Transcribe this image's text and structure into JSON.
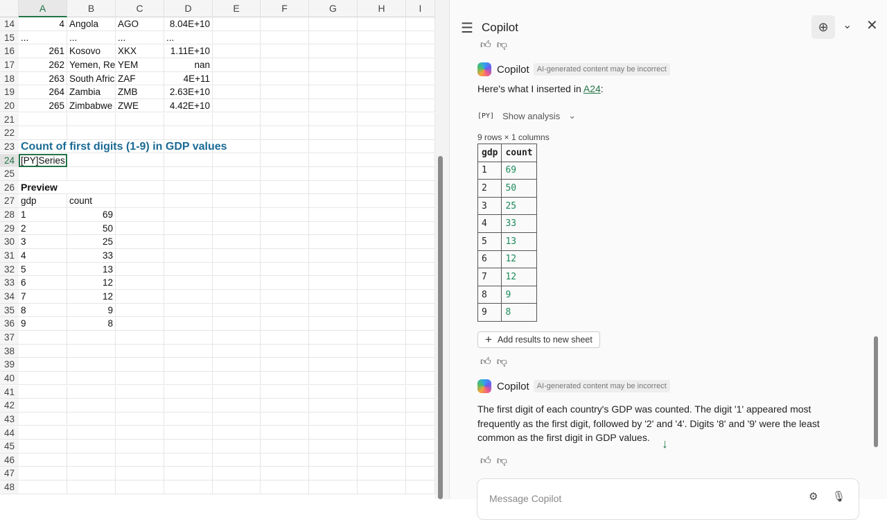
{
  "sheet": {
    "columns": [
      "A",
      "B",
      "C",
      "D",
      "E",
      "F",
      "G",
      "H",
      "I"
    ],
    "rows": [
      {
        "n": "14",
        "cells": [
          {
            "v": "4",
            "num": true
          },
          {
            "v": "Angola"
          },
          {
            "v": "AGO"
          },
          {
            "v": "8.04E+10",
            "num": true
          }
        ]
      },
      {
        "n": "15",
        "cells": [
          {
            "v": "..."
          },
          {
            "v": "..."
          },
          {
            "v": "..."
          },
          {
            "v": "..."
          }
        ]
      },
      {
        "n": "16",
        "cells": [
          {
            "v": "261",
            "num": true
          },
          {
            "v": "Kosovo"
          },
          {
            "v": "XKX"
          },
          {
            "v": "1.11E+10",
            "num": true
          }
        ]
      },
      {
        "n": "17",
        "cells": [
          {
            "v": "262",
            "num": true
          },
          {
            "v": "Yemen, Rep"
          },
          {
            "v": "YEM"
          },
          {
            "v": "nan",
            "num": true
          }
        ]
      },
      {
        "n": "18",
        "cells": [
          {
            "v": "263",
            "num": true
          },
          {
            "v": "South Africa"
          },
          {
            "v": "ZAF"
          },
          {
            "v": "4E+11",
            "num": true
          }
        ]
      },
      {
        "n": "19",
        "cells": [
          {
            "v": "264",
            "num": true
          },
          {
            "v": "Zambia"
          },
          {
            "v": "ZMB"
          },
          {
            "v": "2.63E+10",
            "num": true
          }
        ]
      },
      {
        "n": "20",
        "cells": [
          {
            "v": "265",
            "num": true
          },
          {
            "v": "Zimbabwe"
          },
          {
            "v": "ZWE"
          },
          {
            "v": "4.42E+10",
            "num": true
          }
        ]
      },
      {
        "n": "21",
        "cells": []
      },
      {
        "n": "22",
        "cells": []
      },
      {
        "n": "23",
        "cells": [
          {
            "v": "Count of first digits (1-9) in GDP values",
            "cls": "title ovf"
          }
        ]
      },
      {
        "n": "24",
        "cells": [
          {
            "v": "[PY]Series",
            "cls": "active"
          }
        ]
      },
      {
        "n": "25",
        "cells": []
      },
      {
        "n": "26",
        "cells": [
          {
            "v": "Preview",
            "cls": "bold ovf"
          }
        ]
      },
      {
        "n": "27",
        "cells": [
          {
            "v": "gdp"
          },
          {
            "v": "count"
          }
        ]
      },
      {
        "n": "28",
        "cells": [
          {
            "v": "1"
          },
          {
            "v": "69",
            "num": true
          }
        ]
      },
      {
        "n": "29",
        "cells": [
          {
            "v": "2"
          },
          {
            "v": "50",
            "num": true
          }
        ]
      },
      {
        "n": "30",
        "cells": [
          {
            "v": "3"
          },
          {
            "v": "25",
            "num": true
          }
        ]
      },
      {
        "n": "31",
        "cells": [
          {
            "v": "4"
          },
          {
            "v": "33",
            "num": true
          }
        ]
      },
      {
        "n": "32",
        "cells": [
          {
            "v": "5"
          },
          {
            "v": "13",
            "num": true
          }
        ]
      },
      {
        "n": "33",
        "cells": [
          {
            "v": "6"
          },
          {
            "v": "12",
            "num": true
          }
        ]
      },
      {
        "n": "34",
        "cells": [
          {
            "v": "7"
          },
          {
            "v": "12",
            "num": true
          }
        ]
      },
      {
        "n": "35",
        "cells": [
          {
            "v": "8"
          },
          {
            "v": "9",
            "num": true
          }
        ]
      },
      {
        "n": "36",
        "cells": [
          {
            "v": "9"
          },
          {
            "v": "8",
            "num": true
          }
        ]
      },
      {
        "n": "37",
        "cells": []
      },
      {
        "n": "38",
        "cells": []
      },
      {
        "n": "39",
        "cells": []
      },
      {
        "n": "40",
        "cells": []
      },
      {
        "n": "41",
        "cells": []
      },
      {
        "n": "42",
        "cells": []
      },
      {
        "n": "43",
        "cells": []
      },
      {
        "n": "44",
        "cells": []
      },
      {
        "n": "45",
        "cells": []
      },
      {
        "n": "46",
        "cells": []
      },
      {
        "n": "47",
        "cells": []
      },
      {
        "n": "48",
        "cells": []
      }
    ]
  },
  "copilot": {
    "title": "Copilot",
    "sender": "Copilot",
    "disclaimer": "AI-generated content may be incorrect",
    "inserted_prefix": "Here's what I inserted in ",
    "inserted_link": "A24",
    "inserted_suffix": ":",
    "py_label": "[PY]",
    "show_analysis": "Show analysis",
    "dims": "9 rows × 1 columns",
    "table": {
      "headers": [
        "gdp",
        "count"
      ],
      "rows": [
        [
          "1",
          "69"
        ],
        [
          "2",
          "50"
        ],
        [
          "3",
          "25"
        ],
        [
          "4",
          "33"
        ],
        [
          "5",
          "13"
        ],
        [
          "6",
          "12"
        ],
        [
          "7",
          "12"
        ],
        [
          "8",
          "9"
        ],
        [
          "9",
          "8"
        ]
      ]
    },
    "add_results": "Add results to new sheet",
    "summary": "The first digit of each country's GDP was counted. The digit '1' appeared most frequently as the first digit, followed by '2' and '4'. Digits '8' and '9' were the least common as the first digit in GDP values.",
    "input_placeholder": "Message Copilot",
    "accent": "#217346"
  }
}
